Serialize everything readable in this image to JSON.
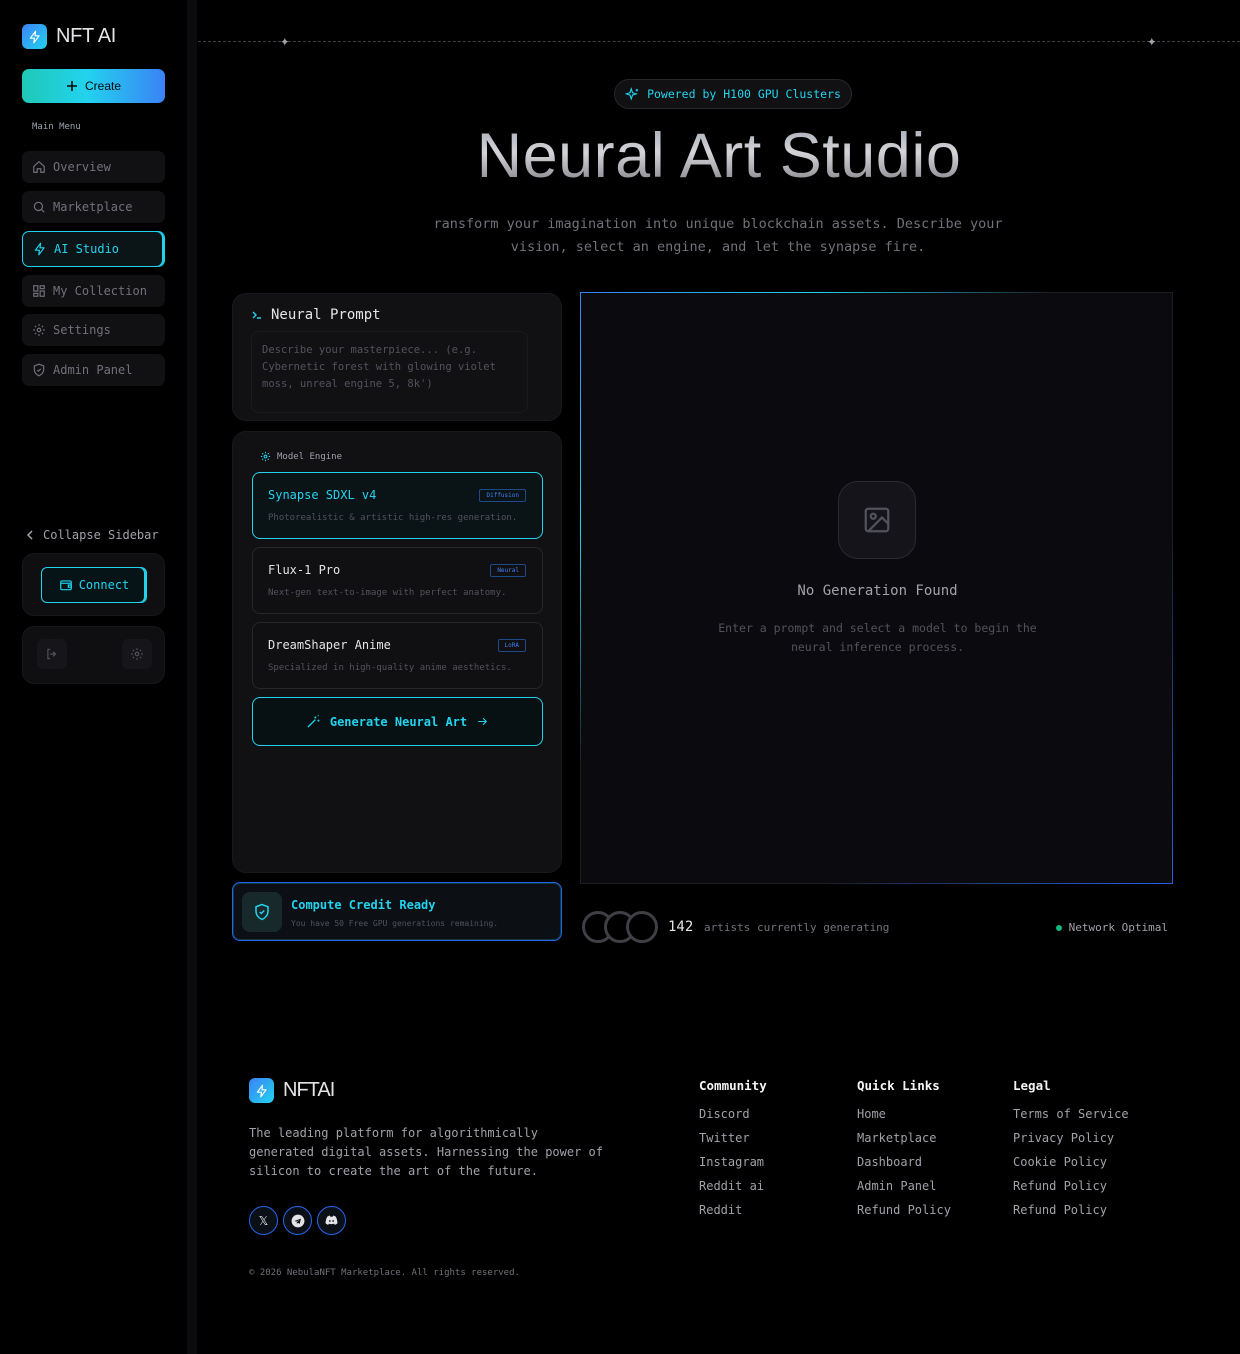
{
  "brand": {
    "name": "NFT AI",
    "footer_name": "NFTAI"
  },
  "sidebar": {
    "create_label": "Create",
    "menu_heading": "Main Menu",
    "items": [
      {
        "label": "Overview",
        "icon": "home-icon",
        "active": false
      },
      {
        "label": "Marketplace",
        "icon": "search-icon",
        "active": false
      },
      {
        "label": "AI Studio",
        "icon": "bolt-icon",
        "active": true
      },
      {
        "label": "My Collection",
        "icon": "grid-icon",
        "active": false
      },
      {
        "label": "Settings",
        "icon": "gear-icon",
        "active": false
      },
      {
        "label": "Admin Panel",
        "icon": "shield-icon",
        "active": false
      }
    ],
    "collapse_label": "Collapse Sidebar",
    "connect_label": "Connect"
  },
  "hero": {
    "badge": "Powered by H100 GPU Clusters",
    "title": "Neural Art Studio",
    "subtitle": "ransform your imagination into unique blockchain assets. Describe your vision, select an engine, and let the synapse fire."
  },
  "prompt": {
    "heading": "Neural Prompt",
    "placeholder": "Describe your masterpiece... (e.g. Cybernetic forest with glowing violet moss, unreal engine 5, 8k')"
  },
  "engine": {
    "heading": "Model Engine",
    "models": [
      {
        "name": "Synapse SDXL v4",
        "tag": "Diffusion",
        "desc": "Photorealistic & artistic high-res generation.",
        "selected": true
      },
      {
        "name": "Flux-1 Pro",
        "tag": "Neural",
        "desc": "Next-gen text-to-image with perfect anatomy.",
        "selected": false
      },
      {
        "name": "DreamShaper Anime",
        "tag": "LoRA",
        "desc": "Specialized in high-quality anime aesthetics.",
        "selected": false
      }
    ],
    "generate_label": "Generate Neural Art"
  },
  "credit": {
    "title": "Compute Credit Ready",
    "subtitle": "You have 50 Free GPU generations remaining."
  },
  "output": {
    "empty_title": "No Generation Found",
    "empty_subtitle": "Enter a prompt and select a model to begin the neural inference process."
  },
  "stats": {
    "artists_count": "142",
    "artists_label": "artists currently generating",
    "network_status": "Network Optimal"
  },
  "footer": {
    "description": "The leading platform for algorithmically generated digital assets. Harnessing the power of silicon to create the art of the future.",
    "socials": [
      "X",
      "Telegram",
      "Discord"
    ],
    "copyright": "© 2026 NebulaNFT Marketplace. All rights reserved.",
    "columns": [
      {
        "heading": "Community",
        "links": [
          "Discord",
          "Twitter",
          "Instagram",
          "Reddit ai",
          "Reddit"
        ]
      },
      {
        "heading": "Quick Links",
        "links": [
          "Home",
          "Marketplace",
          "Dashboard",
          "Admin Panel",
          "Refund Policy"
        ]
      },
      {
        "heading": "Legal",
        "links": [
          "Terms of Service",
          "Privacy Policy",
          "Cookie Policy",
          "Refund Policy",
          "Refund Policy"
        ]
      }
    ]
  },
  "colors": {
    "accent": "#22d3ee",
    "accent_blue": "#3b82f6",
    "status_ok": "#10b981",
    "background": "#000000"
  }
}
